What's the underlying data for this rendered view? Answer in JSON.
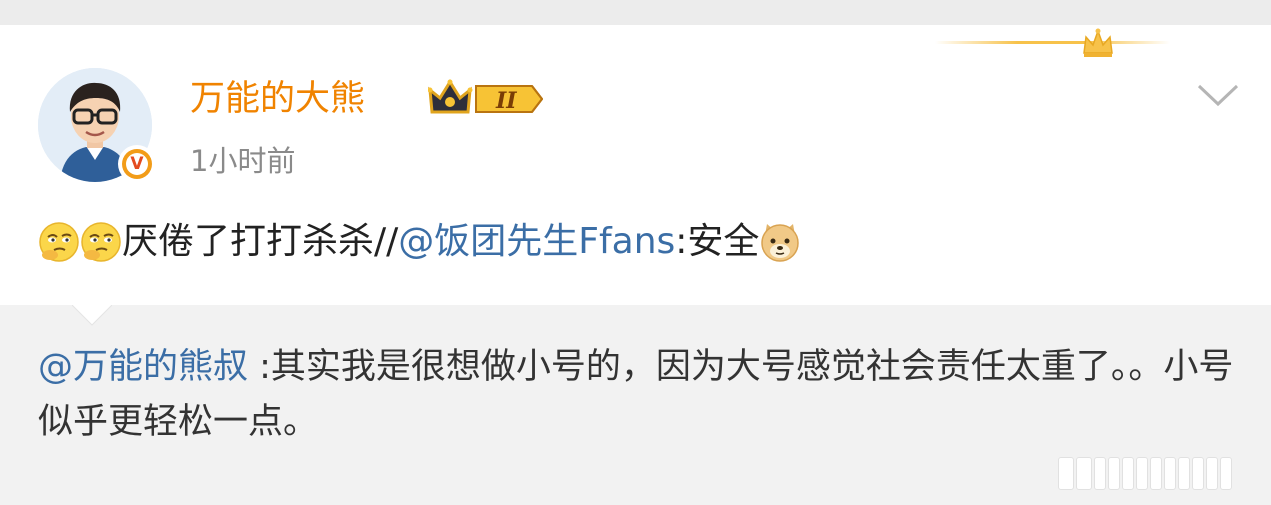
{
  "post": {
    "author": "万能的大熊",
    "level_label": "II",
    "time": "1小时前",
    "text_main": "厌倦了打打杀杀//",
    "mention": "@饭团先生Ffans",
    "text_tail": ":安全"
  },
  "repost": {
    "mention": "@万能的熊叔",
    "text": " :其实我是很想做小号的，因为大号感觉社会责任太重了。。小号似乎更轻松一点。"
  },
  "icons": {
    "avatar": "avatar-image",
    "verified": "verified-v-badge",
    "level": "crown-level-badge",
    "menu": "chevron-down-icon",
    "emoji_1": "thinking-face-emoji",
    "emoji_2": "thinking-face-emoji",
    "emoji_3": "doge-emoji",
    "decoration": "crown-decoration"
  },
  "colors": {
    "username": "#f08300",
    "mention": "#3b6ea6",
    "text": "#222222",
    "time": "#8a8a8a",
    "repost_bg": "#f2f2f2"
  },
  "verified_letter": "V"
}
